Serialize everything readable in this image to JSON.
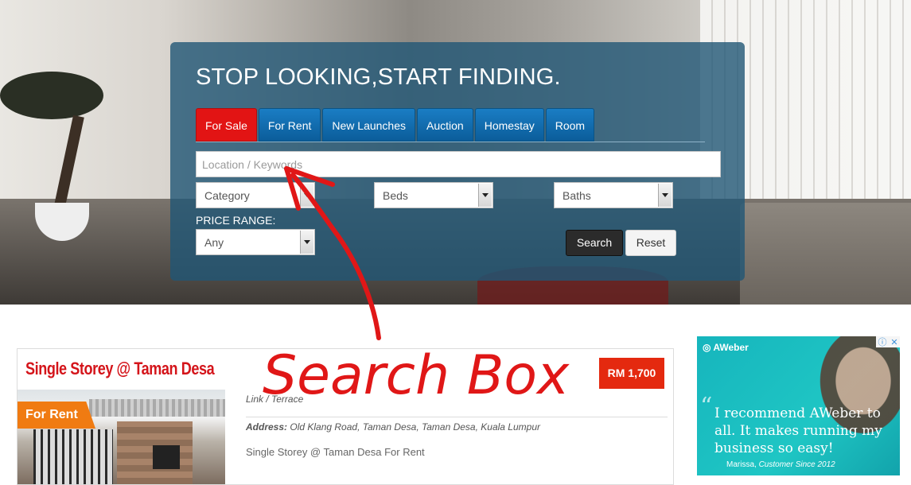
{
  "hero": {
    "headline": "STOP LOOKING,START FINDING."
  },
  "tabs": [
    {
      "label": "For Sale",
      "active": true
    },
    {
      "label": "For Rent"
    },
    {
      "label": "New Launches"
    },
    {
      "label": "Auction"
    },
    {
      "label": "Homestay"
    },
    {
      "label": "Room"
    }
  ],
  "search": {
    "placeholder": "Location / Keywords",
    "category": "Category",
    "beds": "Beds",
    "baths": "Baths",
    "price_range_label": "PRICE RANGE:",
    "price_range_value": "Any",
    "search_button": "Search",
    "reset_button": "Reset"
  },
  "annotation": {
    "text": "Search Box",
    "color": "#e01717"
  },
  "listing": {
    "title": "Single Storey @ Taman Desa",
    "price": "RM 1,700",
    "ribbon": "For Rent",
    "property_type": "Link / Terrace",
    "address_label": "Address:",
    "address": "Old Klang Road, Taman Desa, Taman Desa, Kuala Lumpur",
    "description": "Single Storey @ Taman Desa For Rent"
  },
  "ad": {
    "brand": "AWeber",
    "quote": "I recommend AWeber to all. It makes running my business so easy!",
    "name": "Marissa,",
    "role": "Customer Since 2012"
  },
  "colors": {
    "active_tab": "#e21414",
    "tab": "#0b6fb5",
    "price_badge": "#e4290f",
    "listing_title": "#d4141a",
    "ribbon": "#f07b12"
  }
}
